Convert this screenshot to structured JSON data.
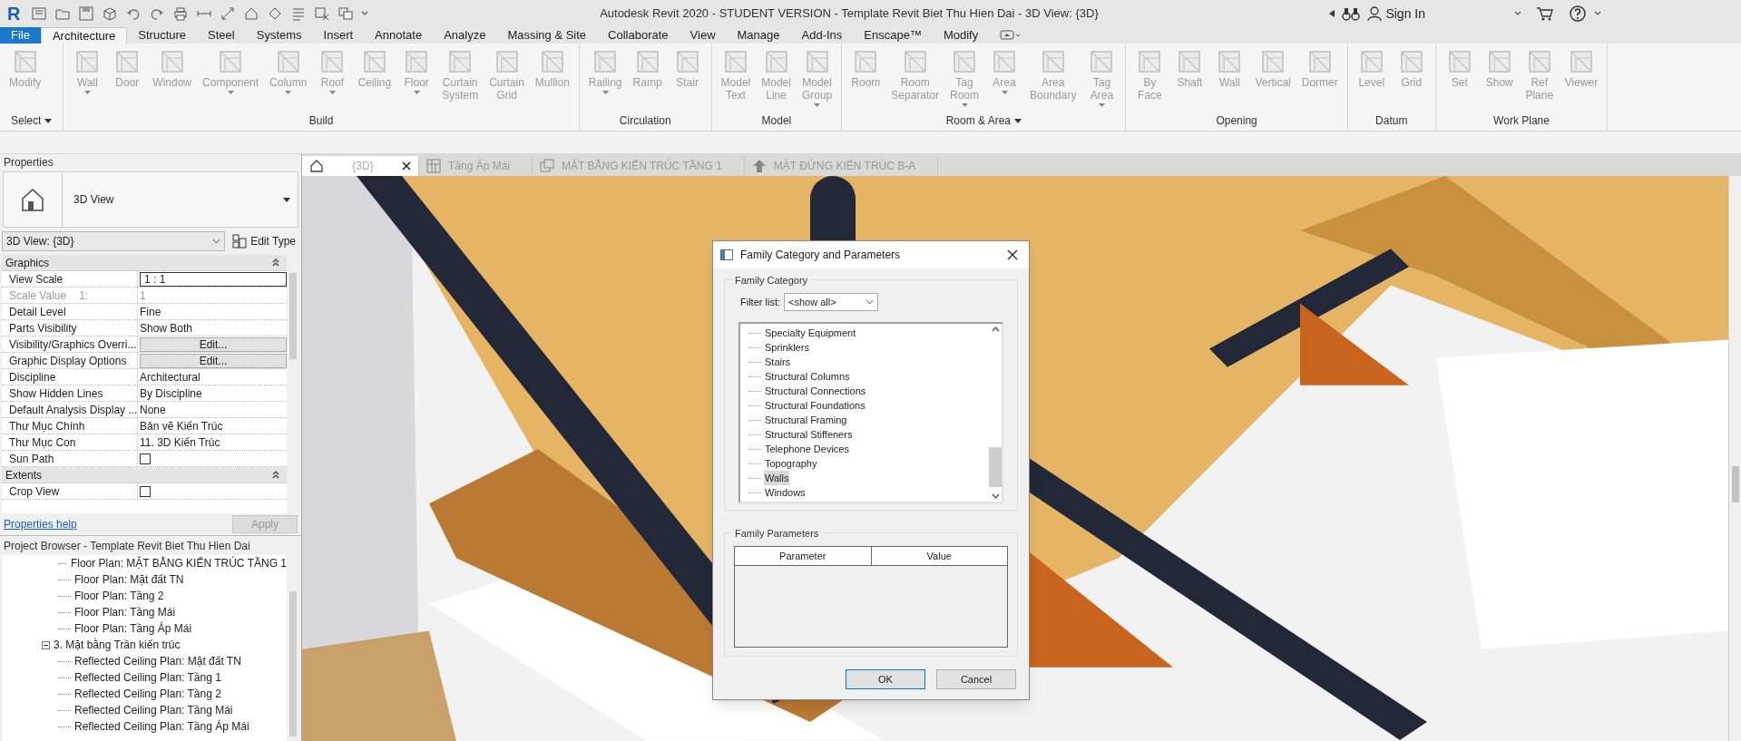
{
  "title_bar": {
    "app_logo": "R",
    "title": "Autodesk Revit 2020 - STUDENT VERSION - Template Revit Biet Thu Hien Dai - 3D View: {3D}",
    "sign_in": "Sign In"
  },
  "ribbon_tabs": [
    {
      "label": "File",
      "kind": "file",
      "selected": false
    },
    {
      "label": "Architecture",
      "kind": "tab",
      "selected": true
    },
    {
      "label": "Structure",
      "kind": "tab",
      "selected": false
    },
    {
      "label": "Steel",
      "kind": "tab",
      "selected": false
    },
    {
      "label": "Systems",
      "kind": "tab",
      "selected": false
    },
    {
      "label": "Insert",
      "kind": "tab",
      "selected": false
    },
    {
      "label": "Annotate",
      "kind": "tab",
      "selected": false
    },
    {
      "label": "Analyze",
      "kind": "tab",
      "selected": false
    },
    {
      "label": "Massing & Site",
      "kind": "tab",
      "selected": false
    },
    {
      "label": "Collaborate",
      "kind": "tab",
      "selected": false
    },
    {
      "label": "View",
      "kind": "tab",
      "selected": false
    },
    {
      "label": "Manage",
      "kind": "tab",
      "selected": false
    },
    {
      "label": "Add-Ins",
      "kind": "tab",
      "selected": false
    },
    {
      "label": "Enscape™",
      "kind": "tab",
      "selected": false
    },
    {
      "label": "Modify",
      "kind": "tab",
      "selected": false
    }
  ],
  "ribbon_panels": [
    {
      "label": "Select",
      "menu": true,
      "tools": [
        {
          "label": "Modify",
          "dropdown": false
        }
      ]
    },
    {
      "label": "Build",
      "menu": false,
      "tools": [
        {
          "label": "Wall",
          "dropdown": true
        },
        {
          "label": "Door",
          "dropdown": false
        },
        {
          "label": "Window",
          "dropdown": false
        },
        {
          "label": "Component",
          "dropdown": true
        },
        {
          "label": "Column",
          "dropdown": true
        },
        {
          "label": "Roof",
          "dropdown": true
        },
        {
          "label": "Ceiling",
          "dropdown": false
        },
        {
          "label": "Floor",
          "dropdown": true
        },
        {
          "label": "Curtain\nSystem",
          "dropdown": false
        },
        {
          "label": "Curtain\nGrid",
          "dropdown": false
        },
        {
          "label": "Mullion",
          "dropdown": false
        }
      ]
    },
    {
      "label": "Circulation",
      "menu": false,
      "tools": [
        {
          "label": "Railing",
          "dropdown": true
        },
        {
          "label": "Ramp",
          "dropdown": false
        },
        {
          "label": "Stair",
          "dropdown": false
        }
      ]
    },
    {
      "label": "Model",
      "menu": false,
      "tools": [
        {
          "label": "Model\nText",
          "dropdown": false
        },
        {
          "label": "Model\nLine",
          "dropdown": false
        },
        {
          "label": "Model\nGroup",
          "dropdown": true
        }
      ]
    },
    {
      "label": "Room & Area",
      "menu": true,
      "tools": [
        {
          "label": "Room",
          "dropdown": false
        },
        {
          "label": "Room\nSeparator",
          "dropdown": false
        },
        {
          "label": "Tag\nRoom",
          "dropdown": true
        },
        {
          "label": "Area",
          "dropdown": true
        },
        {
          "label": "Area\nBoundary",
          "dropdown": false
        },
        {
          "label": "Tag\nArea",
          "dropdown": true
        }
      ]
    },
    {
      "label": "Opening",
      "menu": false,
      "tools": [
        {
          "label": "By\nFace",
          "dropdown": false
        },
        {
          "label": "Shaft",
          "dropdown": false
        },
        {
          "label": "Wall",
          "dropdown": false
        },
        {
          "label": "Vertical",
          "dropdown": false
        },
        {
          "label": "Dormer",
          "dropdown": false
        }
      ]
    },
    {
      "label": "Datum",
      "menu": false,
      "tools": [
        {
          "label": "Level",
          "dropdown": false
        },
        {
          "label": "Grid",
          "dropdown": false
        }
      ]
    },
    {
      "label": "Work Plane",
      "menu": false,
      "tools": [
        {
          "label": "Set",
          "dropdown": false
        },
        {
          "label": "Show",
          "dropdown": false
        },
        {
          "label": "Ref\nPlane",
          "dropdown": false
        },
        {
          "label": "Viewer",
          "dropdown": false
        }
      ]
    }
  ],
  "properties": {
    "title": "Properties",
    "type_name": "3D View",
    "selector": "3D View: {3D}",
    "edit_type": "Edit Type",
    "groups": [
      {
        "label": "Graphics",
        "rows": [
          {
            "name": "View Scale",
            "value": "1 : 1",
            "kind": "input",
            "disabled": false
          },
          {
            "name": "Scale Value",
            "suffix": "1:",
            "value": "1",
            "kind": "text",
            "disabled": true
          },
          {
            "name": "Detail Level",
            "value": "Fine",
            "kind": "text",
            "disabled": false
          },
          {
            "name": "Parts Visibility",
            "value": "Show Both",
            "kind": "text",
            "disabled": false
          },
          {
            "name": "Visibility/Graphics Overri...",
            "value": "Edit...",
            "kind": "button",
            "disabled": false
          },
          {
            "name": "Graphic Display Options",
            "value": "Edit...",
            "kind": "button",
            "disabled": false
          },
          {
            "name": "Discipline",
            "value": "Architectural",
            "kind": "text",
            "disabled": false
          },
          {
            "name": "Show Hidden Lines",
            "value": "By Discipline",
            "kind": "text",
            "disabled": false
          },
          {
            "name": "Default Analysis Display ...",
            "value": "None",
            "kind": "text",
            "disabled": false
          },
          {
            "name": "Thư Mục Chính",
            "value": "Bản vẽ Kiến Trúc",
            "kind": "text",
            "disabled": false
          },
          {
            "name": "Thư Mục Con",
            "value": "11. 3D Kiến Trúc",
            "kind": "text",
            "disabled": false
          },
          {
            "name": "Sun Path",
            "kind": "checkbox",
            "checked": false,
            "disabled": false
          }
        ]
      },
      {
        "label": "Extents",
        "rows": [
          {
            "name": "Crop View",
            "kind": "checkbox",
            "checked": false,
            "disabled": false
          }
        ]
      }
    ],
    "help_link": "Properties help",
    "apply": "Apply"
  },
  "project_browser": {
    "title": "Project Browser - Template Revit Biet Thu Hien Dai",
    "tree": [
      {
        "children": [
          {
            "label": "Floor Plan: MẶT BẰNG KIẾN TRÚC TẦNG 1"
          },
          {
            "label": "Floor Plan: Mặt đất TN"
          },
          {
            "label": "Floor Plan: Tầng 2"
          },
          {
            "label": "Floor Plan: Tầng Mái"
          },
          {
            "label": "Floor Plan: Tầng Áp Mái"
          }
        ]
      },
      {
        "label": "3. Mặt bằng Trần kiến trúc",
        "expanded": true,
        "children": [
          {
            "label": "Reflected Ceiling Plan: Mặt đất TN"
          },
          {
            "label": "Reflected Ceiling Plan: Tầng 1"
          },
          {
            "label": "Reflected Ceiling Plan: Tầng 2"
          },
          {
            "label": "Reflected Ceiling Plan: Tầng Mái"
          },
          {
            "label": "Reflected Ceiling Plan: Tầng Áp Mái"
          }
        ]
      }
    ]
  },
  "view_tabs": [
    {
      "label": "{3D}",
      "kind": "model",
      "selected": true
    },
    {
      "label": "Tầng Áp Mái",
      "kind": "plan",
      "selected": false
    },
    {
      "label": "MẶT BẰNG KIẾN TRÚC TẦNG 1",
      "kind": "sheet",
      "selected": false
    },
    {
      "label": "MẶT ĐỨNG KIẾN TRÚC B-A",
      "kind": "elevation",
      "selected": false
    }
  ],
  "dialog": {
    "title": "Family Category and Parameters",
    "category_group": "Family Category",
    "filter_label": "Filter list:",
    "filter_value": "<show all>",
    "categories": [
      {
        "label": "Specialty Equipment",
        "selected": false
      },
      {
        "label": "Sprinklers",
        "selected": false
      },
      {
        "label": "Stairs",
        "selected": false
      },
      {
        "label": "Structural Columns",
        "selected": false
      },
      {
        "label": "Structural Connections",
        "selected": false
      },
      {
        "label": "Structural Foundations",
        "selected": false
      },
      {
        "label": "Structural Framing",
        "selected": false
      },
      {
        "label": "Structural Stiffeners",
        "selected": false
      },
      {
        "label": "Telephone Devices",
        "selected": false
      },
      {
        "label": "Topography",
        "selected": false
      },
      {
        "label": "Walls",
        "selected": true
      },
      {
        "label": "Windows",
        "selected": false
      }
    ],
    "parameters_group": "Family Parameters",
    "columns": [
      "Parameter",
      "Value"
    ],
    "buttons": [
      {
        "label": "OK",
        "default": true
      },
      {
        "label": "Cancel",
        "default": false
      }
    ]
  }
}
